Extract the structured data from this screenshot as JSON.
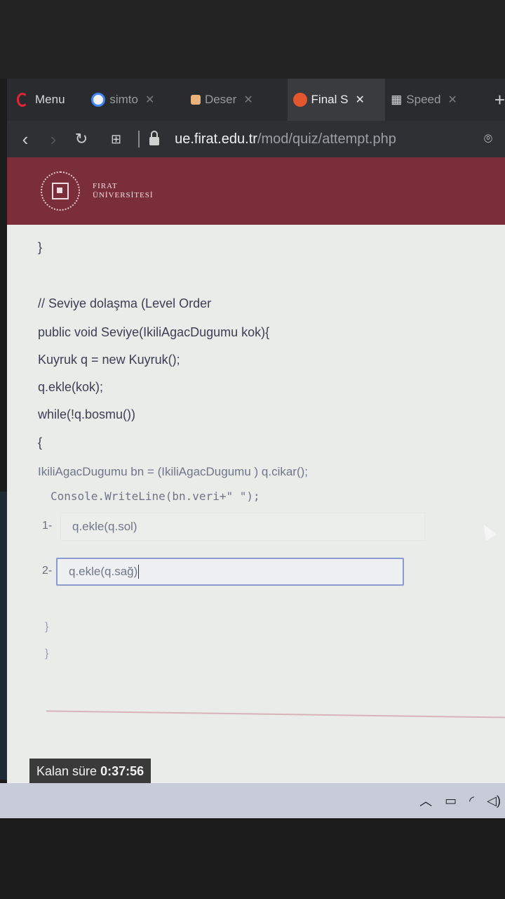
{
  "browser": {
    "tabs": [
      {
        "label": "Menu",
        "icon": "opera-icon"
      },
      {
        "label": "simto",
        "icon": "google-icon"
      },
      {
        "label": "Deser",
        "icon": "tab-favicon"
      },
      {
        "label": "Final S",
        "icon": "tab-favicon"
      },
      {
        "label": "Speed",
        "icon": "speed-dial-icon"
      }
    ],
    "new_tab_symbol": "+",
    "url_host": "ue.firat.edu.tr",
    "url_path": "/mod/quiz/attempt.php"
  },
  "site": {
    "name_line1": "FIRAT",
    "name_line2": "ÜNİVERSİTESİ",
    "brand_color": "#7a2e3a"
  },
  "code_lines": {
    "close_brace_top": "}",
    "comment": "// Seviye dolaşma (Level Order",
    "signature": "public void Seviye(IkiliAgacDugumu kok){",
    "queue_new": "Kuyruk q = new Kuyruk();",
    "enqueue_root": "q.ekle(kok);",
    "while": "while(!q.bosmu())",
    "open_brace": "{",
    "dequeue": "IkiliAgacDugumu  bn = (IkiliAgacDugumu ) q.cikar();",
    "print": "Console.WriteLine(bn.veri+\" \");",
    "close_inner": "}",
    "close_outer": "}"
  },
  "blanks": [
    {
      "number": "1-",
      "value": "q.ekle(q.sol)"
    },
    {
      "number": "2-",
      "value": "q.ekle(q.sağ)"
    }
  ],
  "timer": {
    "label": "Kalan süre",
    "value": "0:37:56"
  }
}
